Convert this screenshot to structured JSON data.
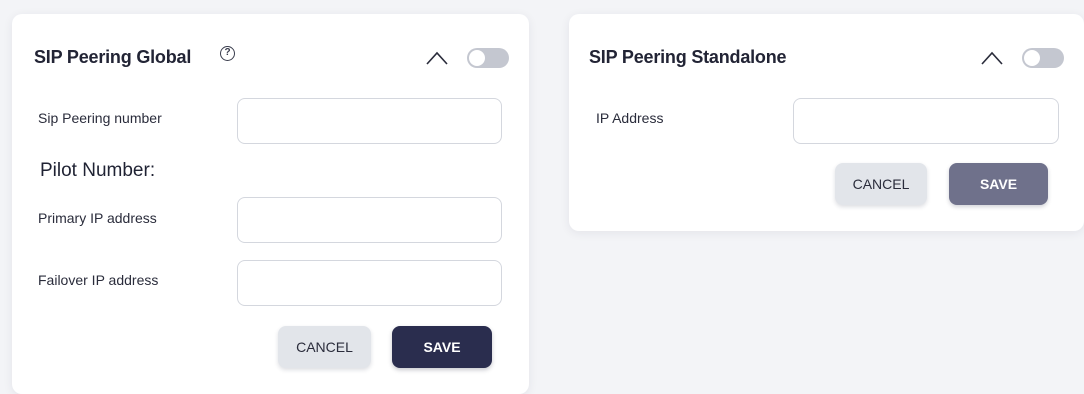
{
  "global_card": {
    "title": "SIP Peering Global",
    "help_glyph": "?",
    "fields": [
      {
        "label": "Sip Peering number",
        "value": "",
        "placeholder": ""
      },
      {
        "label": "Primary IP address",
        "value": "",
        "placeholder": ""
      },
      {
        "label": "Failover IP address",
        "value": "",
        "placeholder": ""
      }
    ],
    "section_heading": "Pilot Number:",
    "cancel_label": "CANCEL",
    "save_label": "SAVE",
    "toggle_on": false
  },
  "standalone_card": {
    "title": "SIP Peering Standalone",
    "fields": [
      {
        "label": "IP Address",
        "value": "",
        "placeholder": ""
      }
    ],
    "cancel_label": "CANCEL",
    "save_label": "SAVE",
    "toggle_on": false
  },
  "icons": {
    "help": "help-circle-icon",
    "collapse": "chevron-up-icon"
  },
  "colors": {
    "page_bg": "#f3f4f7",
    "save_primary": "#2a2d4e",
    "save_muted": "#6f718b",
    "cancel_bg": "#e2e5ea",
    "toggle_off": "#c4c7d0"
  }
}
